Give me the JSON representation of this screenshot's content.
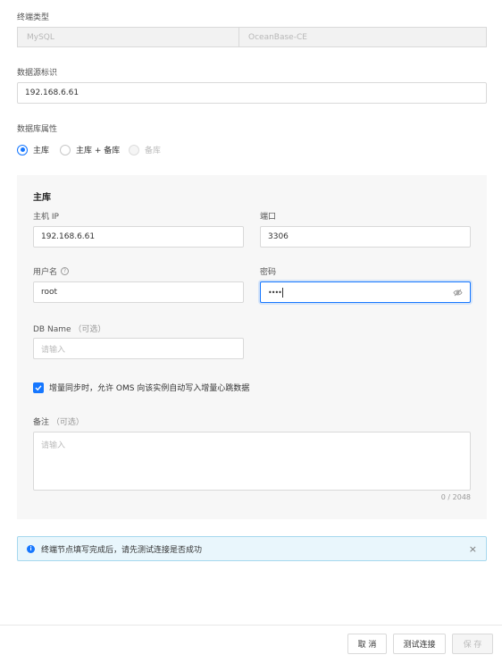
{
  "endpoint_type": {
    "label": "终端类型",
    "options": [
      "MySQL",
      "OceanBase-CE"
    ]
  },
  "datasource_id": {
    "label": "数据源标识",
    "value": "192.168.6.61"
  },
  "db_attr": {
    "label": "数据库属性",
    "options": [
      "主库",
      "主库 + 备库",
      "备库"
    ],
    "selected": "主库"
  },
  "primary": {
    "title": "主库",
    "host_label": "主机 IP",
    "host_value": "192.168.6.61",
    "port_label": "端口",
    "port_value": "3306",
    "user_label": "用户名",
    "user_value": "root",
    "password_label": "密码",
    "password_value": "••••",
    "dbname_label": "DB Name",
    "optional": "（可选）",
    "dbname_placeholder": "请输入",
    "heartbeat_label": "增量同步时，允许 OMS 向该实例自动写入增量心跳数据",
    "heartbeat_checked": true,
    "note_label": "备注",
    "note_placeholder": "请输入",
    "note_count": "0 / 2048"
  },
  "alert": {
    "text": "终端节点填写完成后，请先测试连接是否成功"
  },
  "footer": {
    "cancel": "取 消",
    "test": "测试连接",
    "save": "保 存"
  },
  "colors": {
    "primary": "#1677ff",
    "alert_bg": "#e9f6fc",
    "alert_border": "#a6d8ee"
  }
}
